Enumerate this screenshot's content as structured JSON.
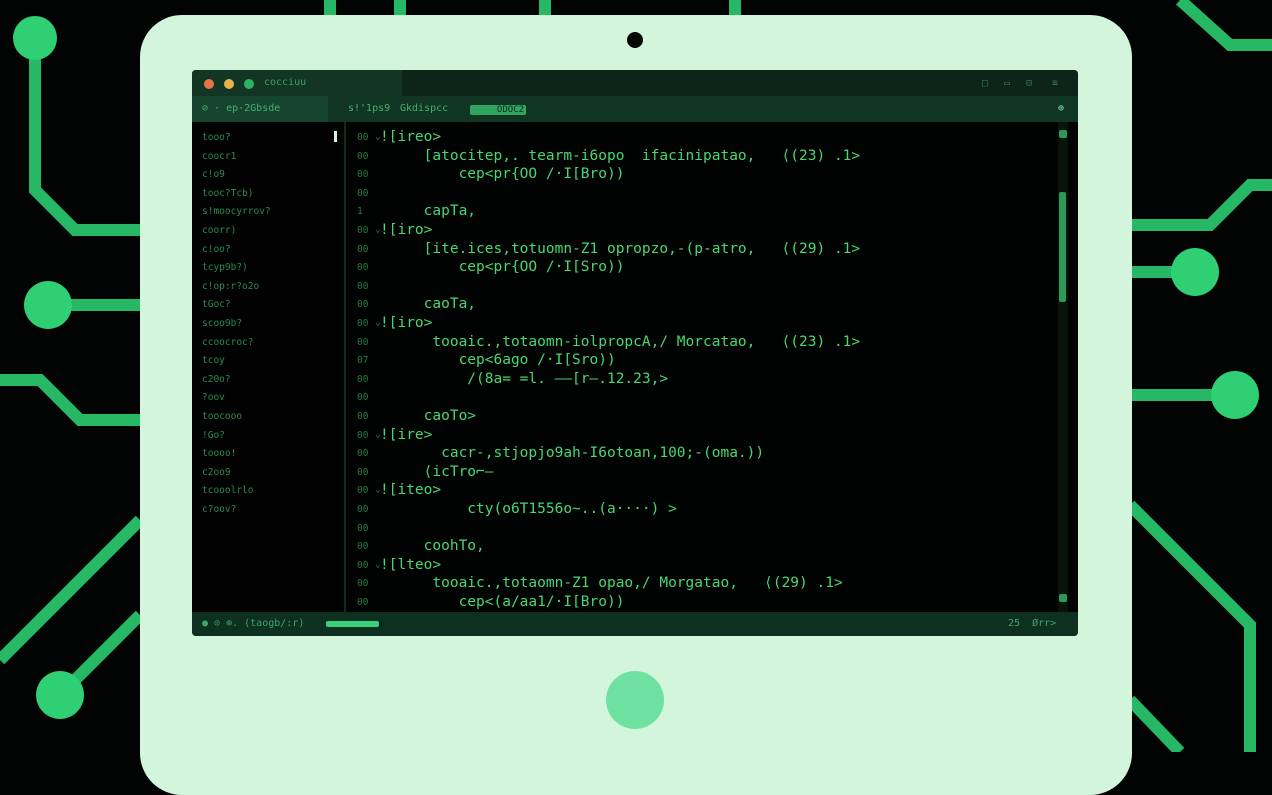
{
  "window": {
    "title": "cocciuu",
    "traffic_lights": [
      "#e8744a",
      "#e7b44a",
      "#2db35d"
    ],
    "controls": [
      "□",
      "▭",
      "⊟",
      "≡"
    ]
  },
  "toolbar": {
    "left_label": "⊘ · ep·2Gbsde",
    "items": [
      "s!'1ps9",
      "Gkdispcc"
    ],
    "badge": "ODOC2",
    "right_icon": "⊕"
  },
  "sidebar": {
    "items": [
      "tooo?",
      "coocr1",
      "c!o9",
      "tooc?Tcb)",
      "s!moocyrrov?",
      "coorr)",
      "c!oo?",
      "tcyp9b?)",
      "c!op:r?o2o",
      "tGoc?",
      "scoo9b?",
      "ccoocroc?",
      "tcoy",
      "c20o?",
      "?oov",
      "toocooo",
      "!Go?",
      "toooo!",
      "c2oo9",
      "tcooolrlo",
      "c?oov?"
    ]
  },
  "editor": {
    "line_numbers": [
      "00",
      "00",
      "00",
      "00",
      "1",
      "00",
      "00",
      "00",
      "00",
      "00",
      "00",
      "00",
      "07",
      "00",
      "00",
      "00",
      "00",
      "00",
      "00",
      "00",
      "00",
      "00",
      "00",
      "00",
      "00",
      "00"
    ],
    "lines": [
      "![ireo>",
      "     [atocitep,. tearm-i6opo  ifacinipatao,   ⟨(23) .1>",
      "         cep<pr{OO /·I[Bro))",
      "",
      "     capTa,",
      "![iro>",
      "     [ite.ices,totuomn-Z1 opropzo,-(p-atro,   ⟨(29) .1>",
      "         cep<pr{OO /·I[Sro))",
      "",
      "     caoTa,",
      "![iro>",
      "      tooaic.,totaomn-iolpropcA,/ Morcatao,   ⟨(23) .1>",
      "         cep<6ago /·I[Sro))",
      "          /(8a= =l. ——[r—.12.23,>",
      "",
      "     caoTo>",
      "![ire>",
      "       cacr-,stjopjo9ah-I6otoan,100;-(oma.))",
      "     ⟨icTro⌐—",
      "![iteo>",
      "          cty(o6T1556o~..(a····) >",
      "",
      "     coohTo,",
      "![lteo>",
      "      tooaic.,totaomn-Z1 opao,/ Morgatao,   ⟨(29) .1>",
      "         cep<(a/aa1/·I[Bro))"
    ],
    "fold_marker": "⌄",
    "scroll_position": 0.25
  },
  "statusbar": {
    "left": "● ⊙ ⊚. (taogb/:r)",
    "progress": 0.95,
    "right": "25  Ørr>"
  },
  "colors": {
    "code": "#49d771",
    "bezel": "#d2f5dc",
    "home_button": "#6fe2a2",
    "circuit": "#2fcf74"
  }
}
